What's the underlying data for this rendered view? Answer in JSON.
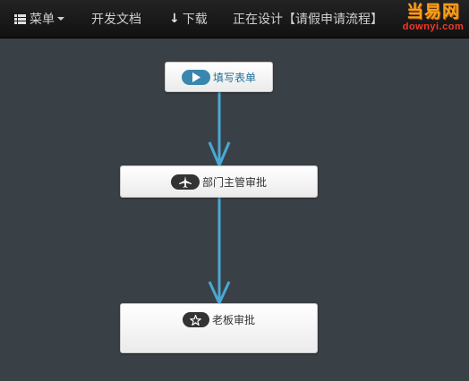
{
  "navbar": {
    "menu_label": "菜单",
    "docs_label": "开发文档",
    "download_label": "下载",
    "design_label": "正在设计【请假申请流程】"
  },
  "logo": {
    "cn_text": "当易网",
    "en_text": "downyi.com"
  },
  "flow": {
    "nodes": [
      {
        "id": "start",
        "label": "填写表单",
        "icon": "play-icon"
      },
      {
        "id": "dept",
        "label": "部门主管审批",
        "icon": "plane-icon"
      },
      {
        "id": "boss",
        "label": "老板审批",
        "icon": "star-icon"
      }
    ],
    "connector_color": "#4aa8d4"
  },
  "colors": {
    "background": "#3a4146",
    "navbar": "#1a1a1a",
    "start_pill": "#3a87ad",
    "dark_pill": "#333333",
    "logo_orange": "#f7a21b",
    "logo_red": "#f03a2a"
  }
}
